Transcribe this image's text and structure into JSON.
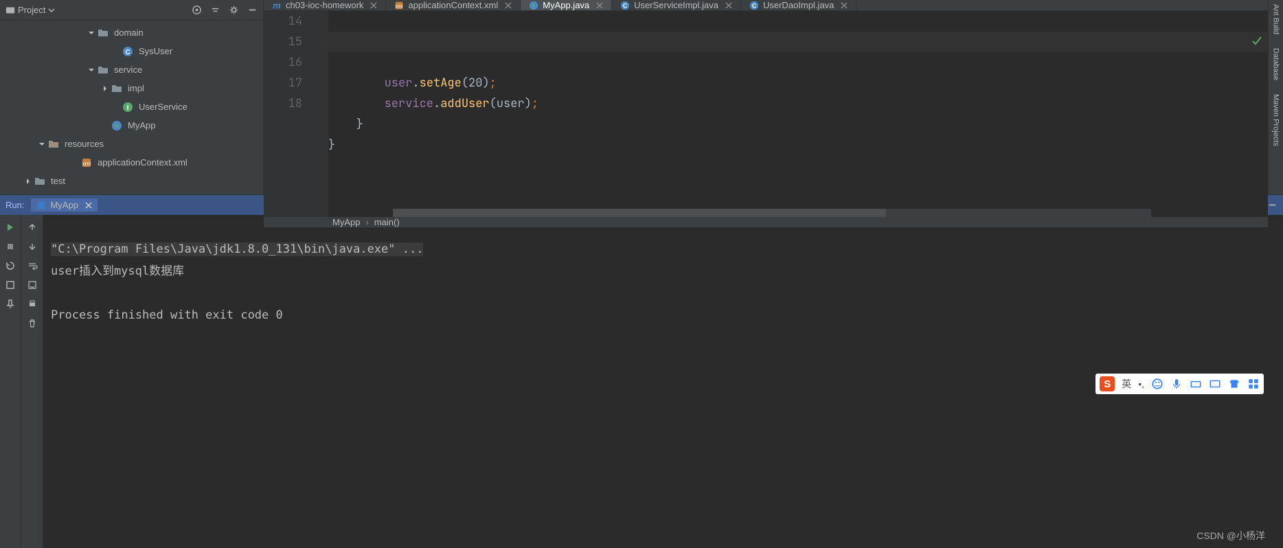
{
  "projectPanel": {
    "title": "Project",
    "tree": [
      {
        "indent": 128,
        "arrow": "down",
        "icon": "folder",
        "label": "domain"
      },
      {
        "indent": 164,
        "arrow": "none",
        "icon": "class-c",
        "label": "SysUser"
      },
      {
        "indent": 128,
        "arrow": "down",
        "icon": "folder",
        "label": "service"
      },
      {
        "indent": 148,
        "arrow": "right",
        "icon": "folder",
        "label": "impl"
      },
      {
        "indent": 164,
        "arrow": "none",
        "icon": "interface",
        "label": "UserService"
      },
      {
        "indent": 148,
        "arrow": "none",
        "icon": "class-main",
        "label": "MyApp"
      },
      {
        "indent": 56,
        "arrow": "down",
        "icon": "folder-res",
        "label": "resources"
      },
      {
        "indent": 104,
        "arrow": "none",
        "icon": "xml",
        "label": "applicationContext.xml"
      },
      {
        "indent": 36,
        "arrow": "right",
        "icon": "folder",
        "label": "test"
      }
    ]
  },
  "tabs": [
    {
      "icon": "maven",
      "label": "ch03-ioc-homework",
      "close": true,
      "active": false
    },
    {
      "icon": "xml",
      "label": "applicationContext.xml",
      "close": true,
      "active": false
    },
    {
      "icon": "class-main",
      "label": "MyApp.java",
      "close": true,
      "active": true
    },
    {
      "icon": "class-c",
      "label": "UserServiceImpl.java",
      "close": true,
      "active": false
    },
    {
      "icon": "class-c",
      "label": "UserDaoImpl.java",
      "close": true,
      "active": false
    }
  ],
  "editor": {
    "lineNumbers": [
      "14",
      "15",
      "16",
      "17",
      "18"
    ],
    "lines": [
      {
        "html": "        <span class='kw-field'>user</span>.<span class='kw-method'>setAge</span>(<span class='kw-param'>20</span>)<span class='kw-punc'>;</span>"
      },
      {
        "html": "        <span class='kw-field'>service</span>.<span class='kw-method'>addUser</span>(user)<span class='kw-punc'>;</span>"
      },
      {
        "html": "    }"
      },
      {
        "html": "}"
      },
      {
        "html": ""
      }
    ]
  },
  "breadcrumb": {
    "class": "MyApp",
    "method": "main()"
  },
  "runPanel": {
    "label": "Run:",
    "tabName": "MyApp",
    "console": {
      "cmd": "\"C:\\Program Files\\Java\\jdk1.8.0_131\\bin\\java.exe\" ...",
      "line1": "user插入到mysql数据库",
      "line2": "",
      "line3": "Process finished with exit code 0"
    }
  },
  "rightRail": [
    {
      "icon": "ant",
      "label": "Ant Build"
    },
    {
      "icon": "db",
      "label": "Database"
    },
    {
      "icon": "maven",
      "label": "Maven Projects"
    }
  ],
  "ime": {
    "lang": "英"
  },
  "watermark": "CSDN @小杨洋"
}
